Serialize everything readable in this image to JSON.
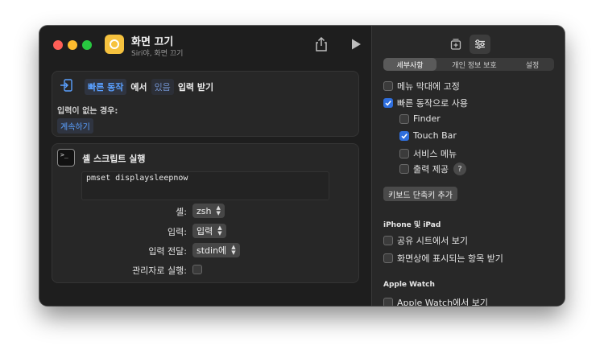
{
  "window": {
    "title": "화면 끄기",
    "subtitle": "Siri야, 화면 끄기"
  },
  "colors": {
    "accent": "#2f6fde",
    "link": "#5aa0ff",
    "app_icon": "#f6c23e"
  },
  "action1": {
    "parts": [
      "빠른 동작",
      "에서",
      "있음",
      "입력 받기"
    ],
    "no_input_label": "입력이 없는 경우:",
    "no_input_value": "계속하기"
  },
  "action2": {
    "icon_glyph": ">_",
    "title": "셸 스크립트 실행",
    "script": "pmset displaysleepnow",
    "shell_label": "셸:",
    "shell_value": "zsh",
    "input_label": "입력:",
    "input_value": "입력",
    "pass_label": "입력 전달:",
    "pass_value": "stdin에",
    "admin_label": "관리자로 실행:"
  },
  "details": {
    "tabs": [
      "세부사항",
      "개인 정보 보호",
      "설정"
    ],
    "options": [
      {
        "label": "메뉴 막대에 고정",
        "checked": false
      },
      {
        "label": "빠른 동작으로 사용",
        "checked": true
      },
      {
        "label": "Finder",
        "checked": false
      },
      {
        "label": "Touch Bar",
        "checked": true
      },
      {
        "label": "서비스 메뉴",
        "checked": false
      },
      {
        "label": "출력 제공",
        "checked": false
      }
    ],
    "help_glyph": "?",
    "keyboard_button": "키보드 단축키 추가",
    "iphone_heading": "iPhone 및 iPad",
    "iphone_options": [
      {
        "label": "공유 시트에서 보기",
        "checked": false
      },
      {
        "label": "화면상에 표시되는 항목 받기",
        "checked": false
      }
    ],
    "watch_heading": "Apple Watch",
    "watch_options": [
      {
        "label": "Apple Watch에서 보기",
        "checked": false
      }
    ]
  }
}
